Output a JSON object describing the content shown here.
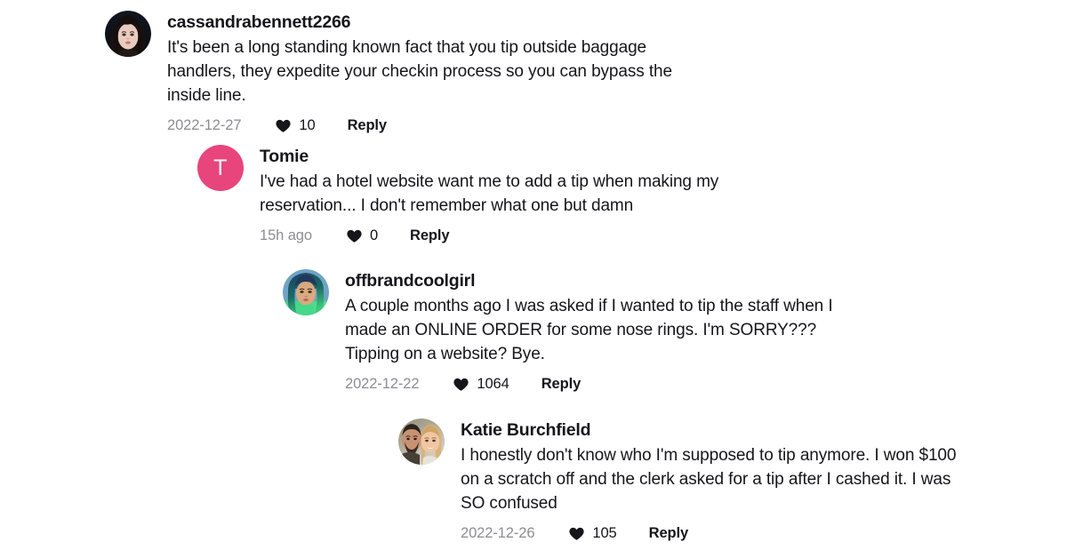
{
  "page": {
    "background_color": "#ffffff",
    "text_color": "#16151a",
    "muted_color": "#8d8d92",
    "accent_color": "#e8457c"
  },
  "icons": {
    "heart": "heart-icon"
  },
  "comments": [
    {
      "level": 0,
      "username": "cassandrabennett2266",
      "text": "It's been a long standing known fact that you tip outside baggage\nhandlers, they expedite your checkin process so you can bypass the\ninside line.",
      "timestamp": "2022-12-27",
      "likes": "10",
      "reply_label": "Reply",
      "avatar": {
        "type": "photo",
        "name": "avatar-cassandrabennett2266",
        "description": "woman with long dark hair, pale skin, dark background"
      }
    },
    {
      "level": 1,
      "username": "Tomie",
      "text": "I've had a hotel website want me to add a tip when making my\nreservation... I don't remember what one but damn",
      "timestamp": "15h ago",
      "likes": "0",
      "reply_label": "Reply",
      "avatar": {
        "type": "letter",
        "name": "avatar-tomie",
        "letter": "T",
        "background_color": "#e8457c",
        "letter_color": "#ffffff"
      }
    },
    {
      "level": 2,
      "username": "offbrandcoolgirl",
      "text": "A couple months ago I was asked if I wanted to tip the staff when I\nmade an ONLINE ORDER for some nose rings. I'm SORRY???\nTipping on a website? Bye.",
      "timestamp": "2022-12-22",
      "likes": "1064",
      "reply_label": "Reply",
      "avatar": {
        "type": "photo",
        "name": "avatar-offbrandcoolgirl",
        "description": "woman with blue and teal hair wearing green top"
      }
    },
    {
      "level": 3,
      "username": "Katie Burchfield",
      "text": "I honestly don't know who I'm supposed to tip anymore. I won $100\non a scratch off and the clerk asked for a tip after I cashed it. I was\nSO confused",
      "timestamp": "2022-12-26",
      "likes": "105",
      "reply_label": "Reply",
      "avatar": {
        "type": "photo",
        "name": "avatar-katie-burchfield",
        "description": "couple selfie, bearded man on left and blonde woman on right"
      }
    }
  ]
}
